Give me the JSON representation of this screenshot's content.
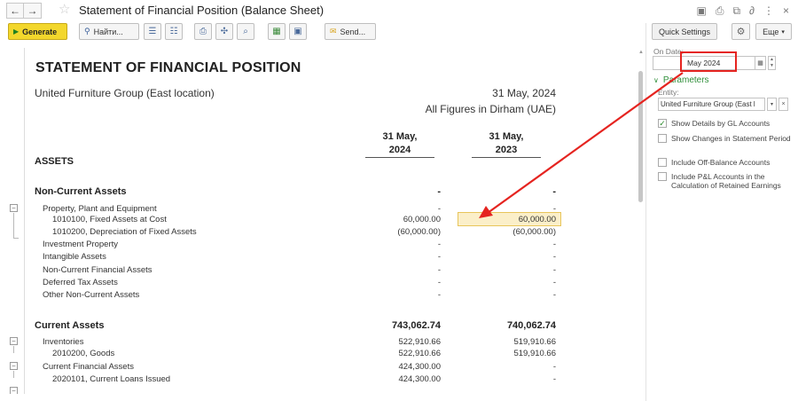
{
  "window": {
    "title": "Statement of Financial Position (Balance Sheet)",
    "back_icon": "arrow-left",
    "forward_icon": "arrow-right"
  },
  "toolbar": {
    "generate_label": "Generate",
    "find_label": "Найти...",
    "send_label": "Send..."
  },
  "report": {
    "title": "STATEMENT OF FINANCIAL POSITION",
    "company": "United Furniture Group (East location)",
    "date": "31 May, 2024",
    "figures": "All Figures in Dirham (UAE)",
    "col1_line1": "31 May,",
    "col1_line2": "2024",
    "col2_line1": "31 May,",
    "col2_line2": "2023",
    "rows": [
      {
        "label": "ASSETS",
        "v1": "",
        "v2": ""
      },
      {
        "label": "Non-Current Assets",
        "v1": "-",
        "v2": "-"
      },
      {
        "label": "Property, Plant and Equipment",
        "v1": "-",
        "v2": "-"
      },
      {
        "label": "1010100, Fixed Assets at Cost",
        "v1": "60,000.00",
        "v2": "60,000.00"
      },
      {
        "label": "1010200, Depreciation of Fixed Assets",
        "v1": "(60,000.00)",
        "v2": "(60,000.00)"
      },
      {
        "label": "Investment Property",
        "v1": "-",
        "v2": "-"
      },
      {
        "label": "Intangible Assets",
        "v1": "-",
        "v2": "-"
      },
      {
        "label": "Non-Current Financial Assets",
        "v1": "-",
        "v2": "-"
      },
      {
        "label": "Deferred Tax Assets",
        "v1": "-",
        "v2": "-"
      },
      {
        "label": "Other Non-Current Assets",
        "v1": "-",
        "v2": "-"
      },
      {
        "label": "Current Assets",
        "v1": "743,062.74",
        "v2": "740,062.74"
      },
      {
        "label": "Inventories",
        "v1": "522,910.66",
        "v2": "519,910.66"
      },
      {
        "label": "2010200, Goods",
        "v1": "522,910.66",
        "v2": "519,910.66"
      },
      {
        "label": "Current Financial Assets",
        "v1": "424,300.00",
        "v2": "-"
      },
      {
        "label": "2020101, Current Loans Issued",
        "v1": "424,300.00",
        "v2": "-"
      }
    ]
  },
  "panel": {
    "quick_settings_label": "Quick Settings",
    "more_label": "Еще",
    "on_date_label": "On Date:",
    "on_date_value": "May 2024",
    "parameters_label": "Parameters",
    "entity_label": "Entity:",
    "entity_value": "United Furniture Group (East l",
    "options": [
      {
        "label": "Show Details by GL Accounts",
        "checked": true
      },
      {
        "label": "Show Changes in Statement Period",
        "checked": false
      },
      {
        "label": "Include Off-Balance Accounts",
        "checked": false
      },
      {
        "label": "Include P&L Accounts in the Calculation of Retained Earnings",
        "checked": false
      }
    ]
  },
  "colors": {
    "generate_bg": "#f3d72c",
    "accent_green": "#2f8f3a",
    "annotation_red": "#e52420",
    "highlight_cell": "#fbefc9"
  }
}
